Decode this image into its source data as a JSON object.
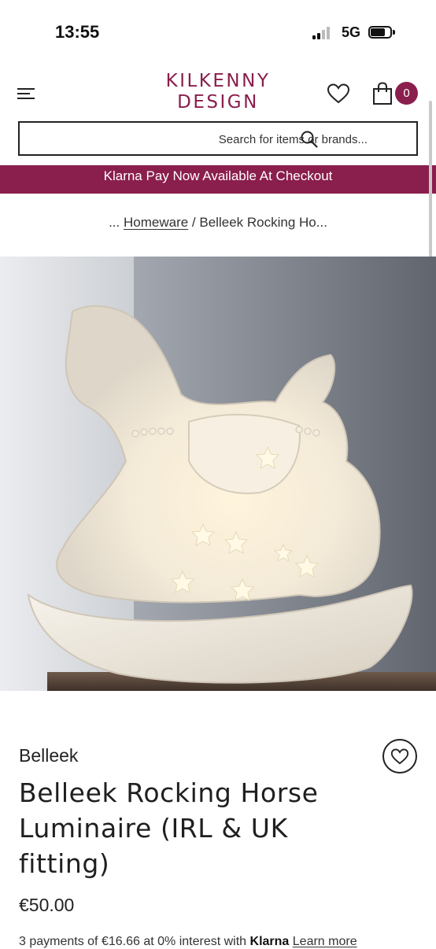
{
  "status_bar": {
    "time": "13:55",
    "network": "5G"
  },
  "header": {
    "logo_line1": "KILKENNY",
    "logo_line2": "DESIGN",
    "cart_count": "0",
    "brand_color": "#8a1e4d"
  },
  "search": {
    "placeholder": "Search for items or brands..."
  },
  "promo": {
    "text": "Klarna Pay Now Available At Checkout"
  },
  "breadcrumb": {
    "ellipsis": "...",
    "link": "Homeware",
    "separator": "/",
    "current": "Belleek Rocking Ho..."
  },
  "carousel": {
    "total": 2,
    "active_index": 0
  },
  "product": {
    "brand": "Belleek",
    "title": "Belleek Rocking Horse Luminaire (IRL & UK fitting)",
    "price": "€50.00",
    "klarna_text_start": "3 payments of €16.66 at 0% interest with",
    "klarna_brand": "Klarna",
    "klarna_link": "Learn more"
  },
  "icons": {
    "menu": "hamburger-menu-icon",
    "wishlist": "heart-icon",
    "cart": "shopping-bag-icon",
    "search": "search-icon"
  }
}
